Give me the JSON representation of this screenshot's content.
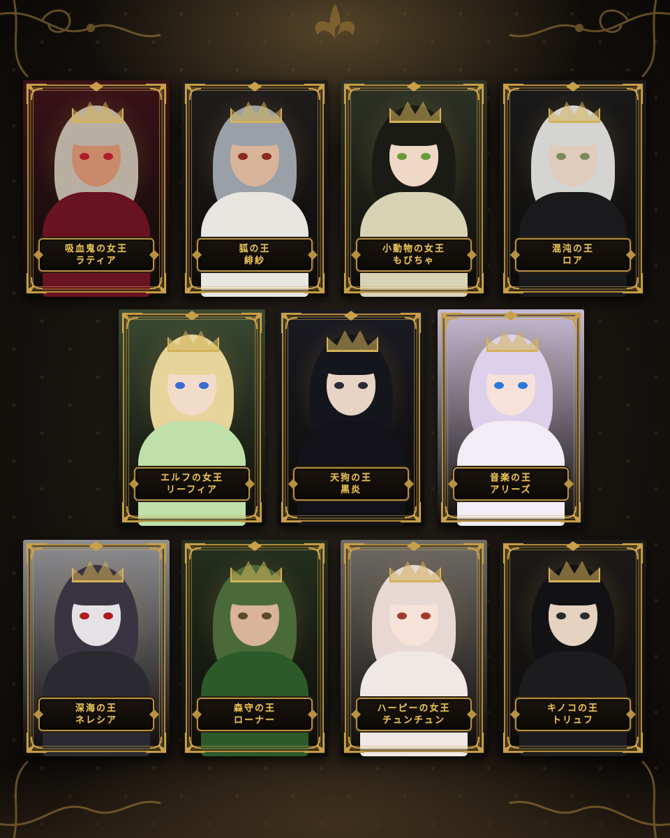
{
  "cards": [
    {
      "title": "吸血鬼の女王",
      "name": "ラティア",
      "bg": "#3a1218",
      "hair": "#b9aea2",
      "skin": "#c98a6a",
      "eye": "#b01c2a",
      "outfit": "#6a1320",
      "accessory": "rose-crown"
    },
    {
      "title": "狐の王",
      "name": "緋紗",
      "bg": "#1f1c1c",
      "hair": "#9aa0a8",
      "skin": "#d8b49a",
      "eye": "#8a2a20",
      "outfit": "#e8e6e0",
      "accessory": "fox-mask"
    },
    {
      "title": "小動物の女王",
      "name": "もびちゃ",
      "bg": "#2e3326",
      "hair": "#1b1b16",
      "skin": "#efd8c6",
      "eye": "#6a9a3a",
      "outfit": "#d9d3b6",
      "accessory": "glowing-crown"
    },
    {
      "title": "混沌の王",
      "name": "ロア",
      "bg": "#1a1a1a",
      "hair": "#d4d4d2",
      "skin": "#e0ccbc",
      "eye": "#7a8a5a",
      "outfit": "#1a1a1c",
      "accessory": "small-tiara"
    },
    {
      "title": "エルフの女王",
      "name": "リーフィア",
      "bg": "#3a4a32",
      "hair": "#e6d49a",
      "skin": "#f0dcc8",
      "eye": "#3a6ad0",
      "outfit": "#bfe0a8",
      "accessory": "leaf-crown"
    },
    {
      "title": "天狗の王",
      "name": "黒炎",
      "bg": "#1a1a22",
      "hair": "#15161c",
      "skin": "#e8d4c4",
      "eye": "#2a2a3a",
      "outfit": "#121218",
      "accessory": "tengu-mask"
    },
    {
      "title": "音楽の王",
      "name": "アリーズ",
      "bg": "#c8bcd6",
      "hair": "#ddd0ea",
      "skin": "#f6e2da",
      "eye": "#2a78d8",
      "outfit": "#f2ecf4",
      "accessory": "cat-ears"
    },
    {
      "title": "深海の王",
      "name": "ネレシア",
      "bg": "#8e8e92",
      "hair": "#3a3442",
      "skin": "#e4e2e6",
      "eye": "#b01c1c",
      "outfit": "#2a2a30",
      "accessory": "veil"
    },
    {
      "title": "森守の王",
      "name": "ローナー",
      "bg": "#24301e",
      "hair": "#4a6a3a",
      "skin": "#d8b49a",
      "eye": "#5a4a2a",
      "outfit": "#2c5a2a",
      "accessory": "vine-wreath"
    },
    {
      "title": "ハーピーの女王",
      "name": "チュンチュン",
      "bg": "#6e6a66",
      "hair": "#e8d8d4",
      "skin": "#f6e2d8",
      "eye": "#a03a2a",
      "outfit": "#f0e8e4",
      "accessory": "pearl-tiara"
    },
    {
      "title": "キノコの王",
      "name": "トリュフ",
      "bg": "#1c1a18",
      "hair": "#121214",
      "skin": "#e6d2c0",
      "eye": "#2a2a2a",
      "outfit": "#1c1c1e",
      "accessory": "face-mask"
    }
  ],
  "colors": {
    "gold": "#b8923f",
    "plate_text": "#e6c35a",
    "wall": "#16120e"
  }
}
